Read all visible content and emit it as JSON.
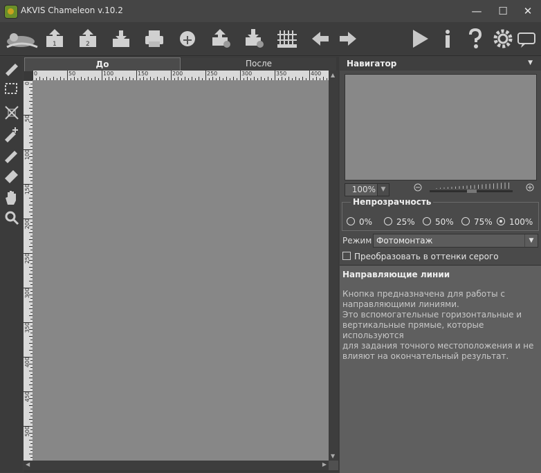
{
  "window": {
    "title": "AKVIS Chameleon v.10.2",
    "minimize": "—",
    "maximize": "☐",
    "close": "✕"
  },
  "toolbar": {
    "items": [
      "logo",
      "open-1",
      "open-2",
      "save",
      "print",
      "share",
      "export-settings",
      "import-settings",
      "guides",
      "back",
      "forward",
      "run",
      "info",
      "help",
      "settings",
      "chat"
    ]
  },
  "tabs": {
    "before": "До",
    "after": "После"
  },
  "ruler": {
    "h": [
      "0",
      "50",
      "100",
      "150",
      "200",
      "250",
      "300",
      "350",
      "400"
    ],
    "v": [
      "0",
      "50",
      "100",
      "150",
      "200",
      "250",
      "300",
      "350",
      "400",
      "450",
      "500"
    ]
  },
  "navigator": {
    "title": "Навигатор",
    "zoom": "100%"
  },
  "opacity": {
    "title": "Непрозрачность",
    "options": [
      "0%",
      "25%",
      "50%",
      "75%",
      "100%"
    ],
    "selected": "100%"
  },
  "mode": {
    "label": "Режим",
    "value": "Фотомонтаж"
  },
  "grayscale": {
    "label": "Преобразовать в оттенки серого",
    "checked": false
  },
  "help": {
    "title": "Направляющие линии",
    "text": "Кнопка предназначена для работы с\nнаправляющими линиями.\nЭто вспомогательные горизонтальные и\nвертикальные прямые, которые используются\nдля задания точного местоположения и не\nвлияют на окончательный результат."
  },
  "colors": {
    "panel": "#4a4a4a",
    "canvas": "#878787",
    "ruler": "#d9d9d9"
  }
}
